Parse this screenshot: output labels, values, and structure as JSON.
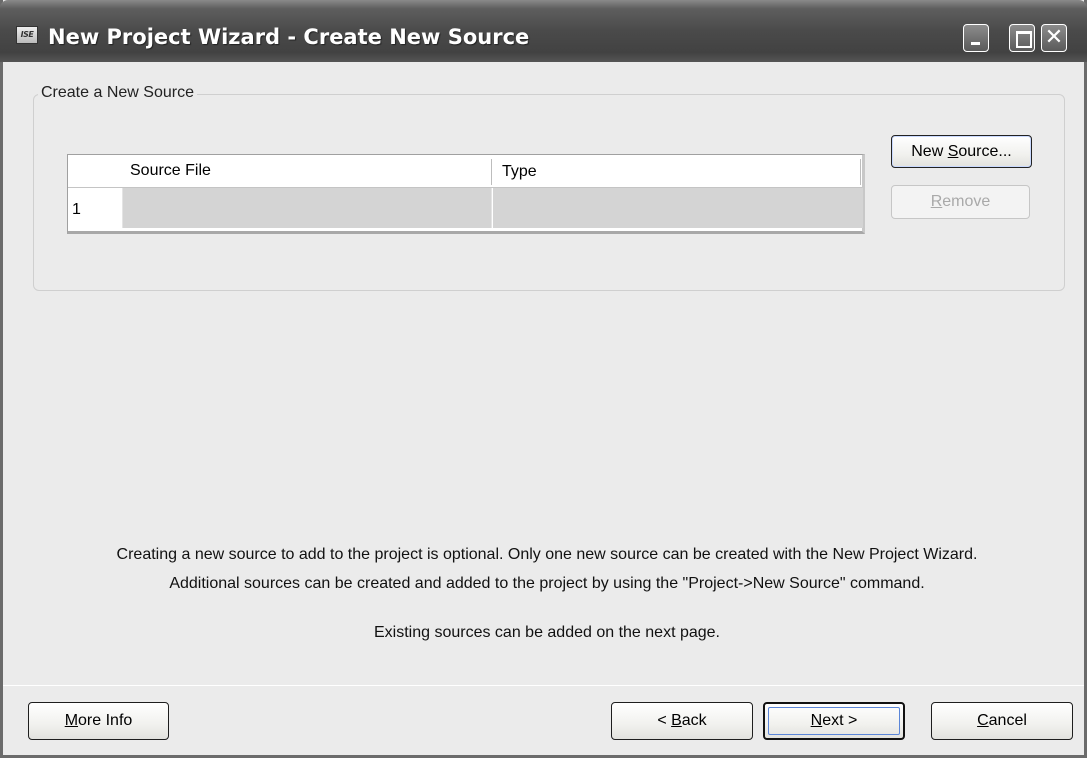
{
  "window": {
    "title": "New Project Wizard - Create New Source",
    "icon_label": "ISE"
  },
  "group": {
    "legend": "Create a New Source"
  },
  "grid": {
    "columns": [
      "Source File",
      "Type"
    ],
    "rows": [
      {
        "num": "1",
        "source_file": "",
        "type": ""
      }
    ]
  },
  "buttons": {
    "new_source": {
      "pre": "New ",
      "accel": "S",
      "post": "ource..."
    },
    "remove": {
      "pre": "",
      "accel": "R",
      "post": "emove"
    },
    "more_info": {
      "pre": "",
      "accel": "M",
      "post": "ore Info"
    },
    "back": {
      "pre": "< ",
      "accel": "B",
      "post": "ack"
    },
    "next": {
      "pre": "",
      "accel": "N",
      "post": "ext >"
    },
    "cancel": {
      "pre": "",
      "accel": "C",
      "post": "ancel"
    }
  },
  "info": {
    "line1": "Creating a new source to add to the project is optional. Only one new source can be created with the New Project Wizard.",
    "line2": "Additional sources can be created and added to the project by using the \"Project->New Source\" command.",
    "line3": "Existing sources can be added on the next page."
  }
}
